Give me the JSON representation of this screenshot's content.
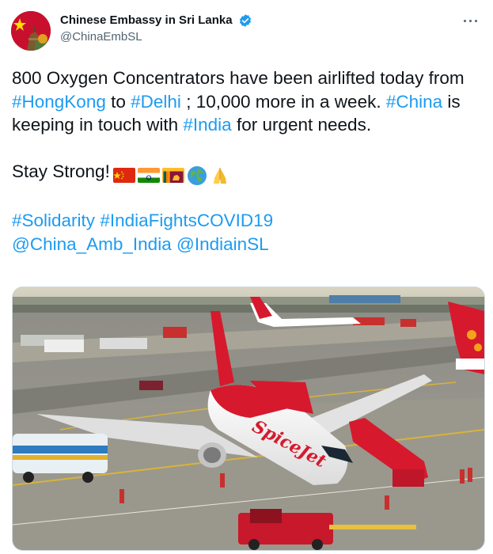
{
  "account": {
    "display_name": "Chinese Embassy in Sri Lanka",
    "handle": "@ChinaEmbSL"
  },
  "tweet": {
    "line1_a": "800 Oxygen Concentrators have been airlifted today from ",
    "tag_hongkong": "#HongKong",
    "line1_b": " to ",
    "tag_delhi": "#Delhi",
    "line1_c": " ; 10,000 more in a week. ",
    "tag_china": "#China",
    "line1_d": " is keeping in touch with ",
    "tag_india": "#India",
    "line1_e": " for urgent needs.",
    "stay_strong": "Stay Strong!",
    "tag_solidarity": "#Solidarity",
    "tag_indiafights": "#IndiaFightsCOVID19",
    "mention_china_amb": "@China_Amb_India",
    "mention_indiainsl": "@IndiainSL"
  },
  "emojis": [
    "china-flag",
    "india-flag",
    "sri-lanka-flag",
    "globe-icon",
    "folded-hands-icon"
  ],
  "media": {
    "airline_livery_text": "SpiceJet"
  },
  "colors": {
    "link": "#1d9bf0",
    "text": "#0f1419",
    "secondary": "#536471",
    "verified": "#1d9bf0",
    "spicejet_red": "#d7192d"
  }
}
